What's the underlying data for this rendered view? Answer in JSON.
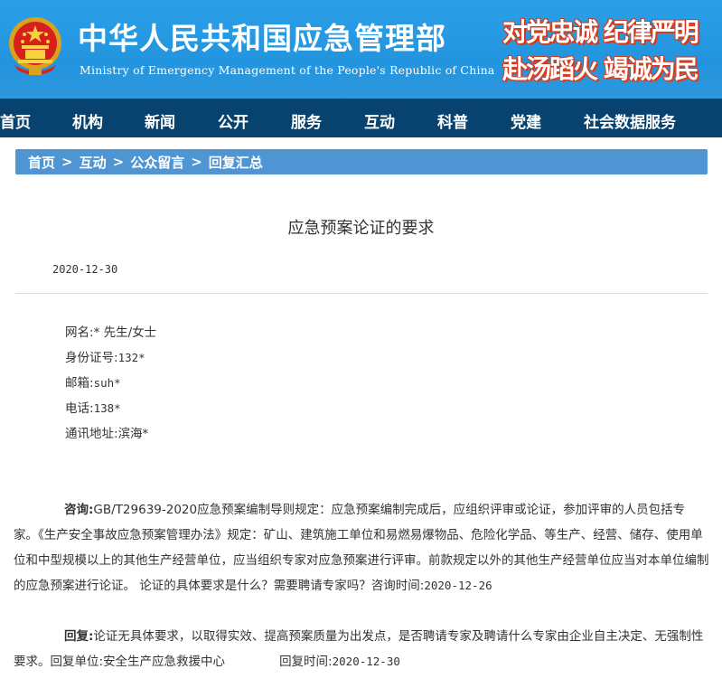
{
  "header": {
    "title": "中华人民共和国应急管理部",
    "subtitle": "Ministry of Emergency Management of the People's Republic of China",
    "slogan_line1": "对党忠诚 纪律严明",
    "slogan_line2": "赴汤蹈火 竭诚为民",
    "colors": {
      "banner": "#1e8fda",
      "nav": "#08436f",
      "breadcrumb": "#4f95d3",
      "slogan_shadow": "#d43a1c"
    }
  },
  "nav": {
    "items": [
      "首页",
      "机构",
      "新闻",
      "公开",
      "服务",
      "互动",
      "科普",
      "党建",
      "社会数据服务"
    ]
  },
  "breadcrumb": {
    "items": [
      "首页",
      "互动",
      "公众留言",
      "回复汇总"
    ],
    "separator": ">"
  },
  "article": {
    "title": "应急预案论证的要求",
    "date": "2020-12-30",
    "info": {
      "name_label": "网名:",
      "name_value": "* 先生/女士",
      "id_label": "身份证号:",
      "id_value": "132*",
      "email_label": "邮箱:",
      "email_value": "suh*",
      "phone_label": "电话:",
      "phone_value": "138*",
      "address_label": "通讯地址:",
      "address_value": "滨海*"
    },
    "question": {
      "label": "咨询:",
      "text": "GB/T29639-2020应急预案编制导则规定：应急预案编制完成后，应组织评审或论证，参加评审的人员包括专家。《生产安全事故应急预案管理办法》规定：矿山、建筑施工单位和易燃易爆物品、危险化学品、等生产、经营、储存、使用单位和中型规模以上的其他生产经营单位，应当组织专家对应急预案进行评审。前款规定以外的其他生产经营单位应当对本单位编制的应急预案进行论证。 论证的具体要求是什么？需要聘请专家吗？",
      "time_label": "咨询时间:",
      "time_value": "2020-12-26"
    },
    "reply": {
      "label": "回复:",
      "text": "论证无具体要求，以取得实效、提高预案质量为出发点，是否聘请专家及聘请什么专家由企业自主决定、无强制性要求。",
      "unit_label": "回复单位:",
      "unit_value": "安全生产应急救援中心",
      "time_label": "回复时间:",
      "time_value": "2020-12-30"
    }
  }
}
